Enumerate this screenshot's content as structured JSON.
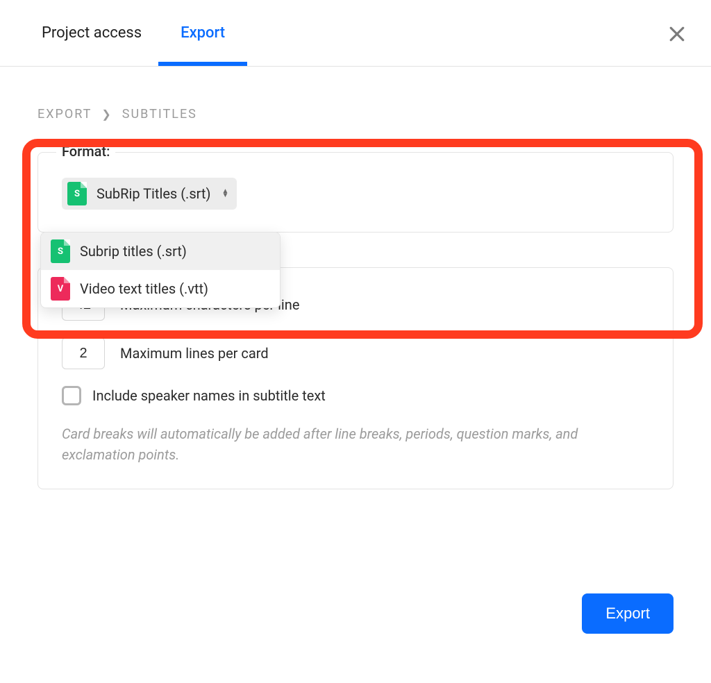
{
  "tabs": {
    "project_access": "Project access",
    "export": "Export"
  },
  "breadcrumb": {
    "root": "Export",
    "leaf": "Subtitles"
  },
  "format": {
    "legend": "Format:",
    "selected_label": "SubRip Titles (.srt)",
    "selected_icon_letter": "S",
    "options": [
      {
        "label": "Subrip titles (.srt)",
        "icon_letter": "S",
        "icon_class": "srt"
      },
      {
        "label": "Video text titles (.vtt)",
        "icon_letter": "V",
        "icon_class": "vtt"
      }
    ]
  },
  "settings": {
    "max_chars_value": "42",
    "max_chars_label": "Maximum characters per line",
    "max_lines_value": "2",
    "max_lines_label": "Maximum lines per card",
    "include_speakers_label": "Include speaker names in subtitle text",
    "hint": "Card breaks will automatically be added after line breaks, periods, question marks, and exclamation points."
  },
  "footer": {
    "export_label": "Export"
  }
}
